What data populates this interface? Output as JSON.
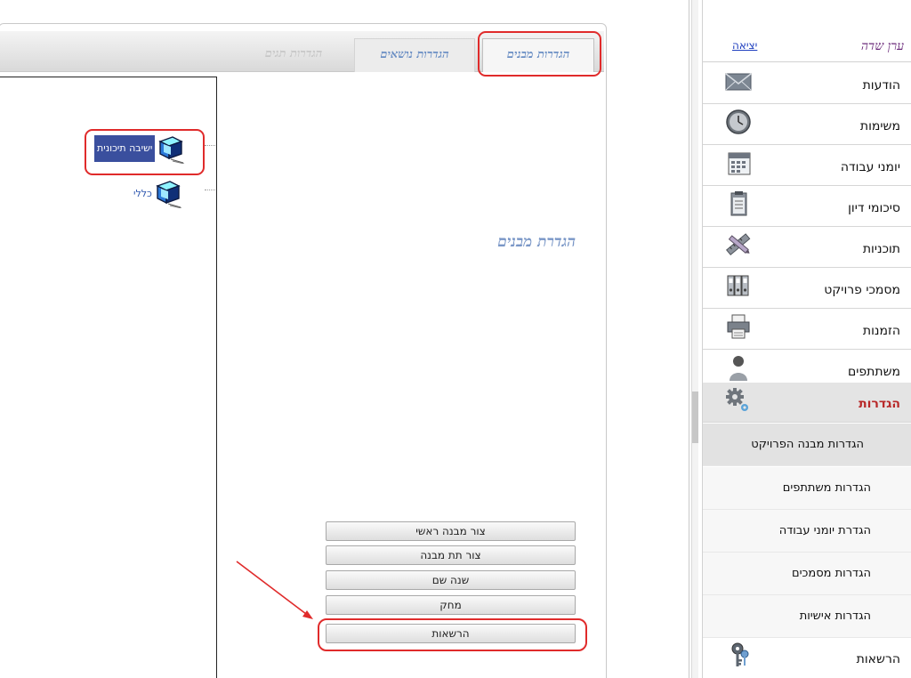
{
  "tabs": [
    {
      "label": "הגדרות מבנים",
      "state": "active"
    },
    {
      "label": "הגדרות נושאים",
      "state": "inactive"
    },
    {
      "label": "הגדרות תגים",
      "state": "disabled"
    }
  ],
  "main": {
    "title": "הגדרת מבנים",
    "tree": [
      {
        "label": "ישיבה תיכונית",
        "selected": true
      },
      {
        "label": "כללי",
        "selected": false
      }
    ],
    "buttons": [
      "צור מבנה ראשי",
      "צור תת מבנה",
      "שנה שם",
      "מחק",
      "הרשאות"
    ]
  },
  "sidebar": {
    "user_name": "ערן שדה",
    "logout": "יציאה",
    "items": [
      {
        "label": "הודעות",
        "icon": "envelope-icon"
      },
      {
        "label": "משימות",
        "icon": "clock-icon"
      },
      {
        "label": "יומני עבודה",
        "icon": "calendar-icon"
      },
      {
        "label": "סיכומי דיון",
        "icon": "clipboard-icon"
      },
      {
        "label": "תוכניות",
        "icon": "ruler-pencil-icon"
      },
      {
        "label": "מסמכי פרויקט",
        "icon": "binders-icon"
      },
      {
        "label": "הזמנות",
        "icon": "printer-icon"
      },
      {
        "label": "משתתפים",
        "icon": "person-icon"
      },
      {
        "label": "הגדרות",
        "icon": "gears-icon"
      }
    ],
    "settings_sub": [
      "הגדרות מבנה הפרויקט",
      "הגדרות משתתפים",
      "הגדרת יומני עבודה",
      "הגדרות מסמכים",
      "הגדרות אישיות"
    ],
    "permissions": {
      "label": "הרשאות",
      "icon": "keys-icon"
    }
  },
  "colors": {
    "highlight": "#e02b2b",
    "tab_text": "#6b8fc4",
    "selected_node_bg": "#3a4f9e",
    "settings_label": "#b82828"
  }
}
